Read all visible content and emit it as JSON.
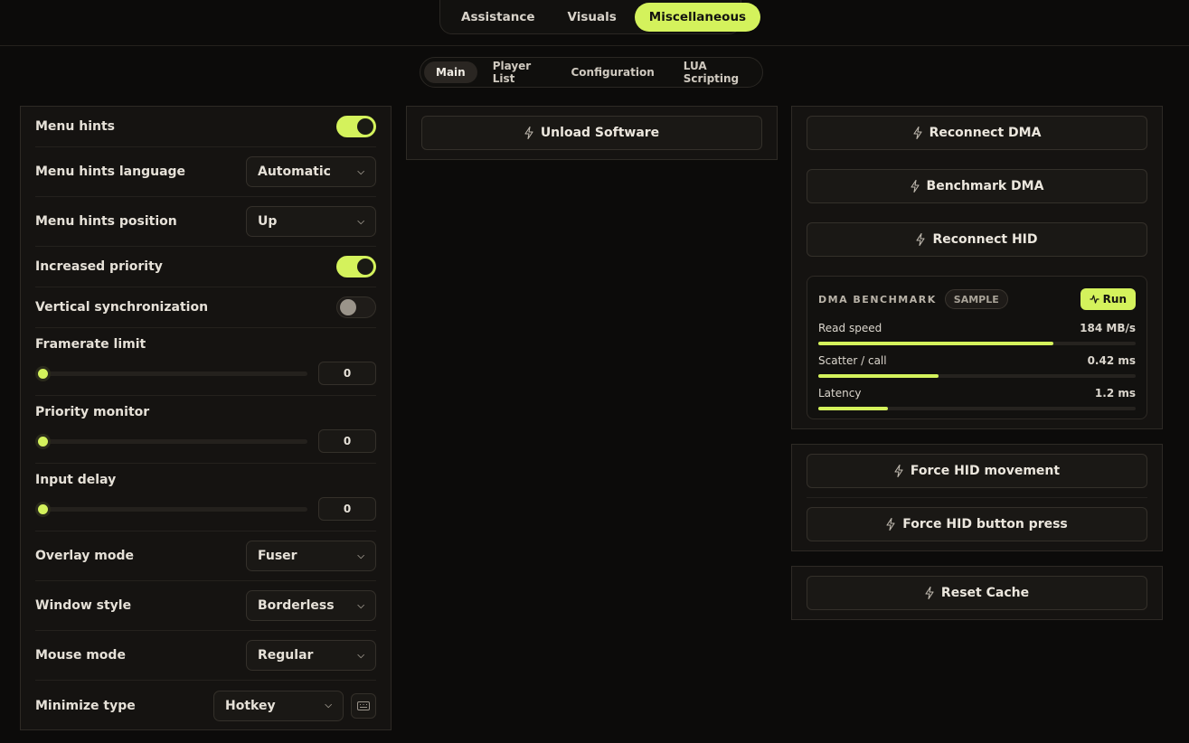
{
  "main_tabs": [
    "Assistance",
    "Visuals",
    "Miscellaneous"
  ],
  "sub_tabs": [
    "Main",
    "Player List",
    "Configuration",
    "LUA Scripting"
  ],
  "settings": {
    "menu_hints": {
      "label": "Menu hints",
      "on": true
    },
    "menu_hints_language": {
      "label": "Menu hints language",
      "value": "Automatic"
    },
    "menu_hints_position": {
      "label": "Menu hints position",
      "value": "Up"
    },
    "increased_priority": {
      "label": "Increased priority",
      "on": true
    },
    "vertical_sync": {
      "label": "Vertical synchronization",
      "on": false
    },
    "framerate_limit": {
      "label": "Framerate limit",
      "value": "0"
    },
    "priority_monitor": {
      "label": "Priority monitor",
      "value": "0"
    },
    "input_delay": {
      "label": "Input delay",
      "value": "0"
    },
    "overlay_mode": {
      "label": "Overlay mode",
      "value": "Fuser"
    },
    "window_style": {
      "label": "Window style",
      "value": "Borderless"
    },
    "mouse_mode": {
      "label": "Mouse mode",
      "value": "Regular"
    },
    "minimize_type": {
      "label": "Minimize type",
      "value": "Hotkey"
    }
  },
  "actions": {
    "unload": "Unload Software",
    "reconnect_dma": "Reconnect DMA",
    "benchmark_dma": "Benchmark DMA",
    "reconnect_hid": "Reconnect HID",
    "force_hid_movement": "Force HID movement",
    "force_hid_button": "Force HID button press",
    "reset_cache": "Reset Cache"
  },
  "benchmark": {
    "title": "DMA BENCHMARK",
    "badge": "SAMPLE",
    "run": "Run",
    "metrics": [
      {
        "label": "Read speed",
        "value": "184 MB/s",
        "fraction": 0.74
      },
      {
        "label": "Scatter / call",
        "value": "0.42 ms",
        "fraction": 0.38
      },
      {
        "label": "Latency",
        "value": "1.2 ms",
        "fraction": 0.22
      }
    ]
  },
  "colors": {
    "accent": "#d4f25c",
    "background": "#0c0b0a",
    "panel": "#151311"
  }
}
